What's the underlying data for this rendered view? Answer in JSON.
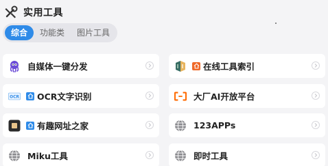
{
  "header": {
    "title": "实用工具",
    "icon": "tools-icon"
  },
  "tabs": [
    {
      "label": "综合",
      "active": true
    },
    {
      "label": "功能类",
      "active": false
    },
    {
      "label": "图片工具",
      "active": false
    }
  ],
  "cards": [
    {
      "label": "自媒体一键分发",
      "icon": "octopus-logo-icon",
      "badge": null
    },
    {
      "label": "在线工具索引",
      "icon": "folder-logo-icon",
      "badge": "orange"
    },
    {
      "label": "OCR文字识别",
      "icon": "ocr-logo-icon",
      "icon_text": "OCR",
      "badge": "blue"
    },
    {
      "label": "大厂AI开放平台",
      "icon": "aliyun-logo-icon",
      "badge": null
    },
    {
      "label": "有趣网址之家",
      "icon": "square-logo-icon",
      "badge": "blue"
    },
    {
      "label": "123APPs",
      "icon": "globe-icon",
      "badge": null
    },
    {
      "label": "Miku工具",
      "icon": "globe-icon",
      "badge": null
    },
    {
      "label": "即时工具",
      "icon": "globe-icon",
      "badge": null
    }
  ],
  "colors": {
    "accent": "#2f8be8",
    "badge_blue": "#2f8be8",
    "badge_orange": "#ef6a2a",
    "background": "#f4f4f6"
  }
}
